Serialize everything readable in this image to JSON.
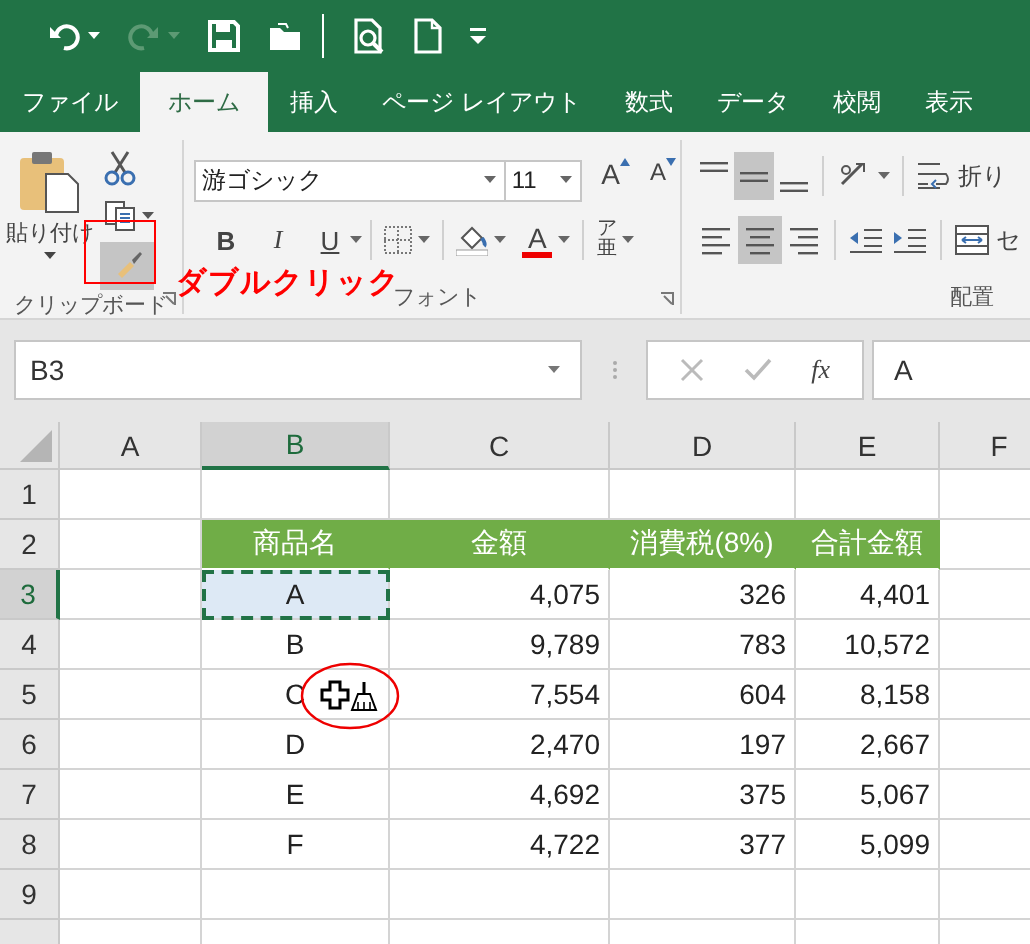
{
  "quick_access": [
    {
      "kind": "undo",
      "disabled": false
    },
    {
      "kind": "redo",
      "disabled": true
    },
    {
      "kind": "save",
      "disabled": false
    },
    {
      "kind": "open",
      "disabled": false
    },
    {
      "kind": "print_preview",
      "disabled": false
    },
    {
      "kind": "new",
      "disabled": false
    },
    {
      "kind": "customize",
      "disabled": false
    }
  ],
  "tabs": [
    {
      "label": "ファイル",
      "selected": false
    },
    {
      "label": "ホーム",
      "selected": true
    },
    {
      "label": "挿入",
      "selected": false
    },
    {
      "label": "ページ レイアウト",
      "selected": false
    },
    {
      "label": "数式",
      "selected": false
    },
    {
      "label": "データ",
      "selected": false
    },
    {
      "label": "校閲",
      "selected": false
    },
    {
      "label": "表示",
      "selected": false
    }
  ],
  "ribbon": {
    "clipboard": {
      "label": "クリップボード",
      "paste_label": "貼り付け",
      "format_painter": {
        "highlighted": true
      }
    },
    "font": {
      "label": "フォント",
      "font_name": "游ゴシック",
      "font_size": "11",
      "grow_label": "A",
      "shrink_label": "A",
      "bold_label": "B",
      "italic_label": "I",
      "underline_label": "U",
      "color_label": "A",
      "phonetic_ruby": "ア",
      "phonetic_label": "亜"
    },
    "alignment": {
      "label": "配置",
      "vertical": [
        {
          "kind": "top",
          "selected": false
        },
        {
          "kind": "middle",
          "selected": true
        },
        {
          "kind": "bottom",
          "selected": false
        }
      ],
      "horizontal": [
        {
          "kind": "left",
          "selected": false
        },
        {
          "kind": "center",
          "selected": true
        },
        {
          "kind": "right",
          "selected": false
        }
      ],
      "wrap_label": "折り",
      "merge_label": "セ"
    }
  },
  "formula_bar": {
    "name_box": "B3",
    "function_label": "fx",
    "formula": "A"
  },
  "sheet": {
    "columns": [
      {
        "label": "A",
        "selected": false
      },
      {
        "label": "B",
        "selected": true
      },
      {
        "label": "C",
        "selected": false
      },
      {
        "label": "D",
        "selected": false
      },
      {
        "label": "E",
        "selected": false
      },
      {
        "label": "F",
        "selected": false
      }
    ],
    "rows": [
      {
        "number": "1",
        "selected": false,
        "kind": "empty"
      },
      {
        "number": "2",
        "selected": false,
        "kind": "header",
        "cells": [
          {
            "text": "商品名",
            "selected": false
          },
          {
            "text": "金額",
            "selected": false
          },
          {
            "text": "消費税(8%)",
            "selected": false
          },
          {
            "text": "合計金額",
            "selected": false
          }
        ]
      },
      {
        "number": "3",
        "selected": true,
        "kind": "data",
        "cells": [
          {
            "text": "A",
            "selected": true
          },
          {
            "text": "4,075",
            "selected": false
          },
          {
            "text": "326",
            "selected": false
          },
          {
            "text": "4,401",
            "selected": false
          }
        ]
      },
      {
        "number": "4",
        "selected": false,
        "kind": "data",
        "cells": [
          {
            "text": "B",
            "selected": false
          },
          {
            "text": "9,789",
            "selected": false
          },
          {
            "text": "783",
            "selected": false
          },
          {
            "text": "10,572",
            "selected": false
          }
        ]
      },
      {
        "number": "5",
        "selected": false,
        "kind": "data",
        "cells": [
          {
            "text": "C",
            "selected": false
          },
          {
            "text": "7,554",
            "selected": false
          },
          {
            "text": "604",
            "selected": false
          },
          {
            "text": "8,158",
            "selected": false
          }
        ]
      },
      {
        "number": "6",
        "selected": false,
        "kind": "data",
        "cells": [
          {
            "text": "D",
            "selected": false
          },
          {
            "text": "2,470",
            "selected": false
          },
          {
            "text": "197",
            "selected": false
          },
          {
            "text": "2,667",
            "selected": false
          }
        ]
      },
      {
        "number": "7",
        "selected": false,
        "kind": "data",
        "cells": [
          {
            "text": "E",
            "selected": false
          },
          {
            "text": "4,692",
            "selected": false
          },
          {
            "text": "375",
            "selected": false
          },
          {
            "text": "5,067",
            "selected": false
          }
        ]
      },
      {
        "number": "8",
        "selected": false,
        "kind": "data",
        "cells": [
          {
            "text": "F",
            "selected": false
          },
          {
            "text": "4,722",
            "selected": false
          },
          {
            "text": "377",
            "selected": false
          },
          {
            "text": "5,099",
            "selected": false
          }
        ]
      },
      {
        "number": "9",
        "selected": false,
        "kind": "empty"
      }
    ]
  },
  "cursor": {
    "kind": "format_painter"
  },
  "annotations": [
    {
      "kind": "box"
    },
    {
      "kind": "label",
      "text": "ダブルクリック"
    },
    {
      "kind": "ellipse"
    }
  ]
}
